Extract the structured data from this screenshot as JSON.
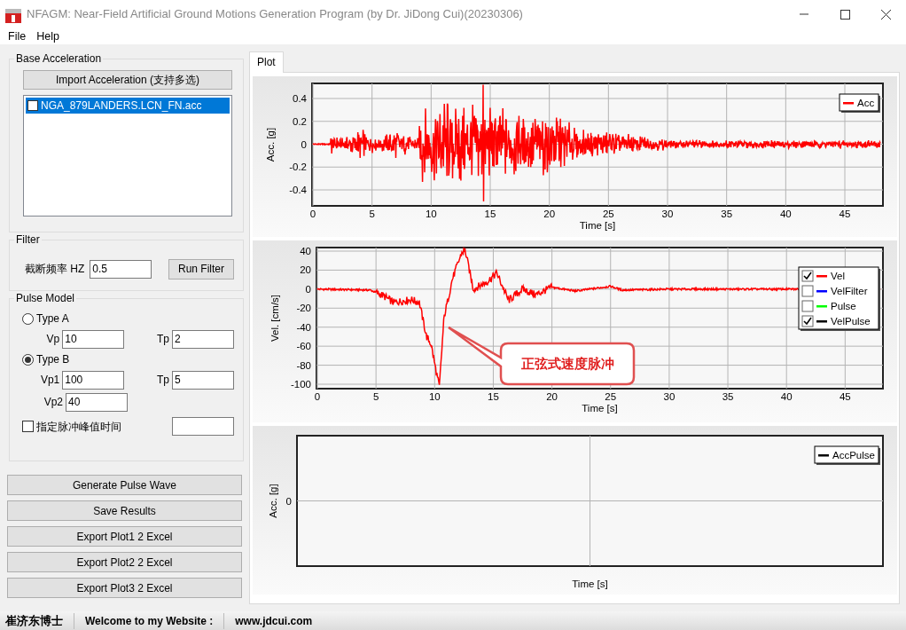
{
  "window": {
    "title": "NFAGM: Near-Field Artificial Ground Motions Generation Program (by Dr. JiDong Cui)(20230306)"
  },
  "menu": [
    {
      "label": "File"
    },
    {
      "label": "Help"
    }
  ],
  "base_acceleration": {
    "title": "Base Acceleration",
    "import_button": "Import Acceleration (支持多选)",
    "files": [
      {
        "name": "NGA_879LANDERS.LCN_FN.acc",
        "checked": false,
        "selected": true
      }
    ]
  },
  "filter": {
    "title": "Filter",
    "cutoff_label": "截断频率 HZ",
    "cutoff_value": "0.5",
    "run_button": "Run Filter"
  },
  "pulse_model": {
    "title": "Pulse Model",
    "types": [
      {
        "label": "Type A",
        "selected": false,
        "fields": [
          {
            "label": "Vp",
            "value": "10"
          },
          {
            "label": "Tp",
            "value": "2"
          }
        ]
      },
      {
        "label": "Type B",
        "selected": true,
        "fields": [
          {
            "label": "Vp1",
            "value": "100"
          },
          {
            "label": "Tp",
            "value": "5"
          },
          {
            "label": "Vp2",
            "value": "40"
          }
        ]
      }
    ],
    "peak_time": {
      "label": "指定脉冲峰值时间",
      "checked": false
    }
  },
  "actions": [
    "Generate Pulse Wave",
    "Save Results",
    "Export Plot1 2 Excel",
    "Export Plot2 2 Excel",
    "Export Plot3 2 Excel"
  ],
  "tabs": [
    {
      "label": "Plot",
      "selected": true
    }
  ],
  "plots": [
    {
      "kind": "acceleration",
      "ylabel": "Acc. [g]",
      "xlabel": "Time [s]",
      "yticks": [
        "0.4",
        "0.2",
        "0",
        "-0.2",
        "-0.4"
      ],
      "xticks": [
        "0",
        "5",
        "10",
        "15",
        "20",
        "25",
        "30",
        "35",
        "40",
        "45"
      ],
      "legend": [
        {
          "label": "Acc",
          "color": "#ff0000"
        }
      ]
    },
    {
      "kind": "velocity",
      "ylabel": "Vel. [cm/s]",
      "xlabel": "Time [s]",
      "yticks": [
        "40",
        "20",
        "0",
        "-20",
        "-40",
        "-60",
        "-80",
        "-100"
      ],
      "xticks": [
        "0",
        "5",
        "10",
        "15",
        "20",
        "25",
        "30",
        "35",
        "40",
        "45"
      ],
      "legend": [
        {
          "label": "Vel",
          "color": "#ff0000",
          "checked": true
        },
        {
          "label": "VelFilter",
          "color": "#0000ff",
          "checked": false
        },
        {
          "label": "Pulse",
          "color": "#00ff00",
          "checked": false
        },
        {
          "label": "VelPulse",
          "color": "#000000",
          "checked": true
        }
      ],
      "callout": "正弦式速度脉冲"
    },
    {
      "kind": "empty",
      "ylabel": "Acc. [g]",
      "xlabel": "Time [s]",
      "yticks": [
        "0"
      ],
      "legend": [
        {
          "label": "AccPulse",
          "color": "#000000"
        }
      ]
    }
  ],
  "status_bar": [
    "崔济东博士",
    "Welcome to my Website :",
    "www.jdcui.com"
  ]
}
